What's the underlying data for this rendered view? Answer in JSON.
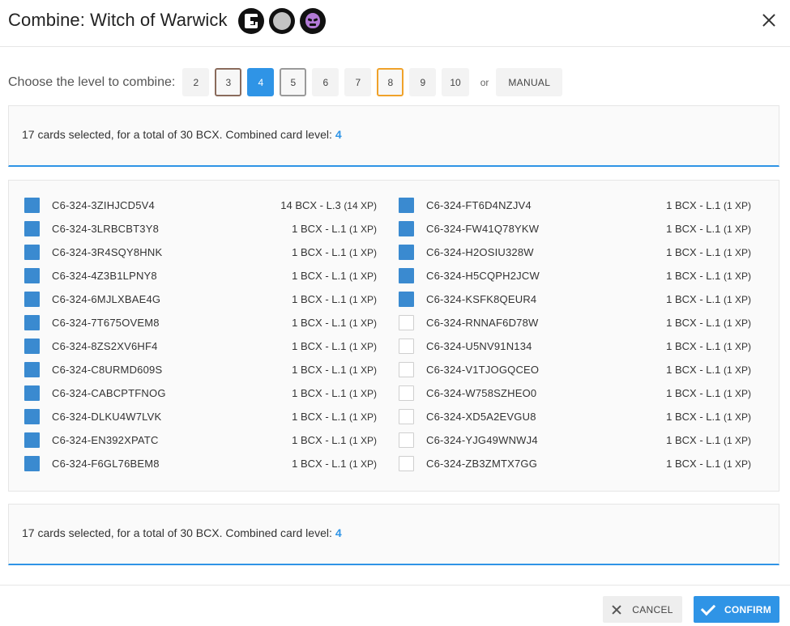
{
  "dialog": {
    "title": "Combine: Witch of Warwick",
    "icons": [
      "edition-g-icon",
      "foil-circle-icon",
      "purple-skull-icon"
    ]
  },
  "level_selector": {
    "label": "Choose the level to combine:",
    "levels": [
      "2",
      "3",
      "4",
      "5",
      "6",
      "7",
      "8",
      "9",
      "10"
    ],
    "selected": "4",
    "or_text": "or",
    "manual_label": "MANUAL"
  },
  "summary": {
    "text": "17 cards selected, for a total of 30 BCX. Combined card level:",
    "level": "4"
  },
  "cards": [
    {
      "id": "C6-324-3ZIHJCD5V4",
      "value": "14 BCX - L.3",
      "xp": "(14 XP)",
      "checked": true
    },
    {
      "id": "C6-324-FT6D4NZJV4",
      "value": "1 BCX - L.1",
      "xp": "(1 XP)",
      "checked": true
    },
    {
      "id": "C6-324-3LRBCBT3Y8",
      "value": "1 BCX - L.1",
      "xp": "(1 XP)",
      "checked": true
    },
    {
      "id": "C6-324-FW41Q78YKW",
      "value": "1 BCX - L.1",
      "xp": "(1 XP)",
      "checked": true
    },
    {
      "id": "C6-324-3R4SQY8HNK",
      "value": "1 BCX - L.1",
      "xp": "(1 XP)",
      "checked": true
    },
    {
      "id": "C6-324-H2OSIU328W",
      "value": "1 BCX - L.1",
      "xp": "(1 XP)",
      "checked": true
    },
    {
      "id": "C6-324-4Z3B1LPNY8",
      "value": "1 BCX - L.1",
      "xp": "(1 XP)",
      "checked": true
    },
    {
      "id": "C6-324-H5CQPH2JCW",
      "value": "1 BCX - L.1",
      "xp": "(1 XP)",
      "checked": true
    },
    {
      "id": "C6-324-6MJLXBAE4G",
      "value": "1 BCX - L.1",
      "xp": "(1 XP)",
      "checked": true
    },
    {
      "id": "C6-324-KSFK8QEUR4",
      "value": "1 BCX - L.1",
      "xp": "(1 XP)",
      "checked": true
    },
    {
      "id": "C6-324-7T675OVEM8",
      "value": "1 BCX - L.1",
      "xp": "(1 XP)",
      "checked": true
    },
    {
      "id": "C6-324-RNNAF6D78W",
      "value": "1 BCX - L.1",
      "xp": "(1 XP)",
      "checked": false
    },
    {
      "id": "C6-324-8ZS2XV6HF4",
      "value": "1 BCX - L.1",
      "xp": "(1 XP)",
      "checked": true
    },
    {
      "id": "C6-324-U5NV91N134",
      "value": "1 BCX - L.1",
      "xp": "(1 XP)",
      "checked": false
    },
    {
      "id": "C6-324-C8URMD609S",
      "value": "1 BCX - L.1",
      "xp": "(1 XP)",
      "checked": true
    },
    {
      "id": "C6-324-V1TJOGQCEO",
      "value": "1 BCX - L.1",
      "xp": "(1 XP)",
      "checked": false
    },
    {
      "id": "C6-324-CABCPTFNOG",
      "value": "1 BCX - L.1",
      "xp": "(1 XP)",
      "checked": true
    },
    {
      "id": "C6-324-W758SZHEO0",
      "value": "1 BCX - L.1",
      "xp": "(1 XP)",
      "checked": false
    },
    {
      "id": "C6-324-DLKU4W7LVK",
      "value": "1 BCX - L.1",
      "xp": "(1 XP)",
      "checked": true
    },
    {
      "id": "C6-324-XD5A2EVGU8",
      "value": "1 BCX - L.1",
      "xp": "(1 XP)",
      "checked": false
    },
    {
      "id": "C6-324-EN392XPATC",
      "value": "1 BCX - L.1",
      "xp": "(1 XP)",
      "checked": true
    },
    {
      "id": "C6-324-YJG49WNWJ4",
      "value": "1 BCX - L.1",
      "xp": "(1 XP)",
      "checked": false
    },
    {
      "id": "C6-324-F6GL76BEM8",
      "value": "1 BCX - L.1",
      "xp": "(1 XP)",
      "checked": true
    },
    {
      "id": "C6-324-ZB3ZMTX7GG",
      "value": "1 BCX - L.1",
      "xp": "(1 XP)",
      "checked": false
    }
  ],
  "footer": {
    "cancel_label": "CANCEL",
    "confirm_label": "CONFIRM"
  },
  "colors": {
    "accent": "#2f94e6",
    "checkbox_checked": "#3a8ad0",
    "level_3_border": "#8a6b5c",
    "level_5_border": "#9a9a9a",
    "level_8_border": "#f0a22a"
  }
}
